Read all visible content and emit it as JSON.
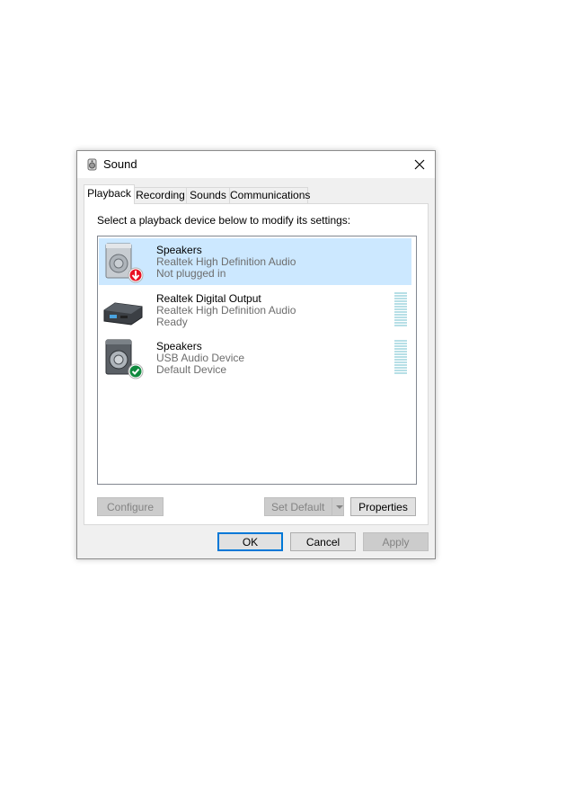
{
  "dialog": {
    "title": "Sound"
  },
  "tabs": [
    {
      "label": "Playback"
    },
    {
      "label": "Recording"
    },
    {
      "label": "Sounds"
    },
    {
      "label": "Communications"
    }
  ],
  "playback": {
    "instruction": "Select a playback device below to modify its settings:",
    "devices": [
      {
        "name": "Speakers",
        "driver": "Realtek High Definition Audio",
        "status": "Not plugged in",
        "icon": "speaker-unplugged-icon"
      },
      {
        "name": "Realtek Digital Output",
        "driver": "Realtek High Definition Audio",
        "status": "Ready",
        "icon": "digital-output-icon"
      },
      {
        "name": "Speakers",
        "driver": "USB Audio Device",
        "status": "Default Device",
        "icon": "speaker-default-icon"
      }
    ]
  },
  "buttons": {
    "configure": "Configure",
    "set_default": "Set Default",
    "properties": "Properties",
    "ok": "OK",
    "cancel": "Cancel",
    "apply": "Apply"
  },
  "colors": {
    "selection": "#cce8ff",
    "accent": "#0078d7",
    "unplugged": "#e81123",
    "default": "#10893e"
  }
}
